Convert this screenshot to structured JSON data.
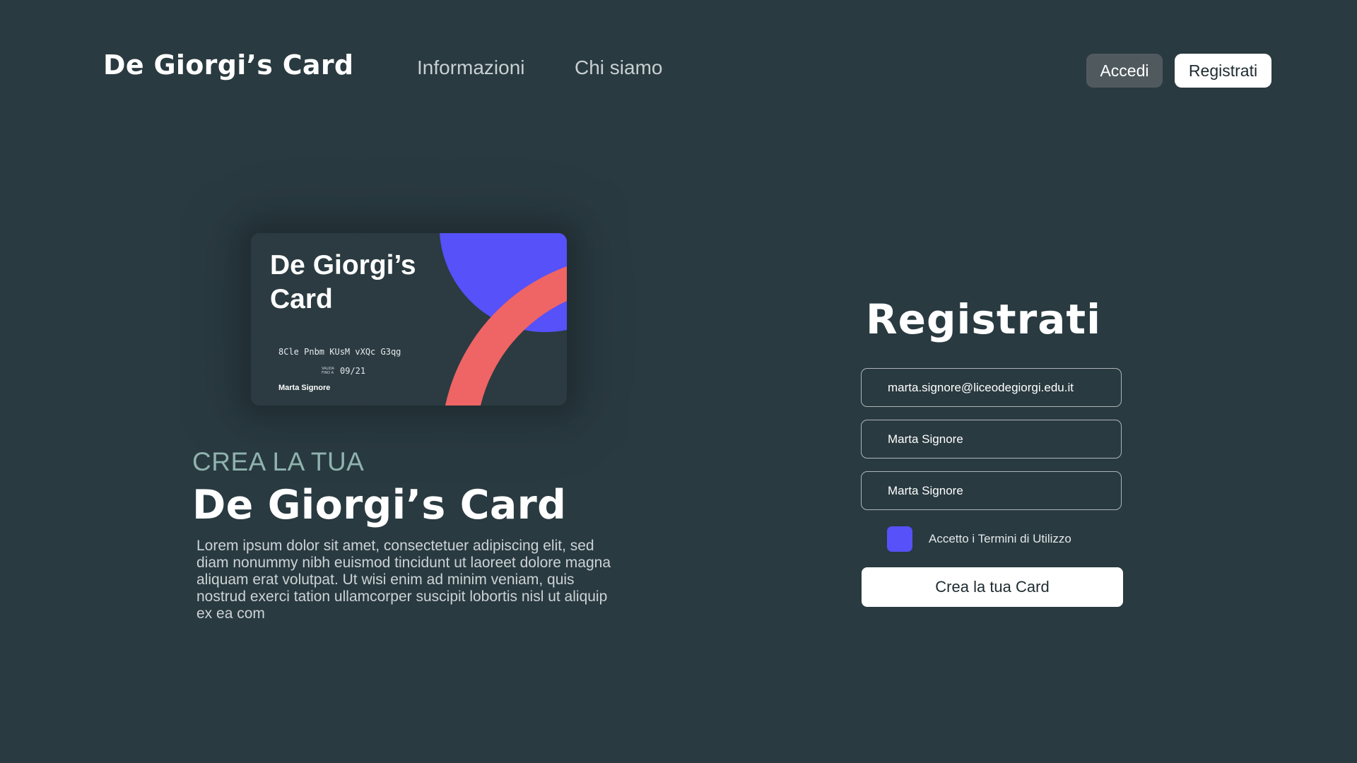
{
  "header": {
    "logo": "De Giorgi’s Card",
    "nav": {
      "info": "Informazioni",
      "about": "Chi siamo"
    },
    "login_label": "Accedi",
    "register_label": "Registrati"
  },
  "card": {
    "title": "De Giorgi’s Card",
    "number": "8Cle Pnbm KUsM vXQc G3qg",
    "valid_label": "VALIDA FINO A",
    "expiry": "09/21",
    "holder": "Marta Signore"
  },
  "hero": {
    "kicker": "CREA LA TUA",
    "title": "De Giorgi’s Card",
    "body": "Lorem ipsum dolor sit amet, consectetuer adipiscing elit, sed diam nonummy nibh euismod tincidunt ut la­oreet dolore magna aliquam erat volutpat. Ut wisi enim ad minim veniam, quis nostrud exerci tation ul­lamcorper suscipit lobortis nisl ut aliquip ex ea com"
  },
  "form": {
    "title": "Registrati",
    "email_value": "marta.signore@liceodegiorgi.edu.it",
    "name_value": "Marta Signore",
    "surname_value": "Marta Signore",
    "terms_label": "Accetto i Termini di Utilizzo",
    "terms_checked": true,
    "submit_label": "Crea la tua Card"
  },
  "colors": {
    "background": "#293a40",
    "accent_purple": "#5651f8",
    "accent_coral": "#ef6464",
    "kicker_teal": "#8fb3ae"
  }
}
